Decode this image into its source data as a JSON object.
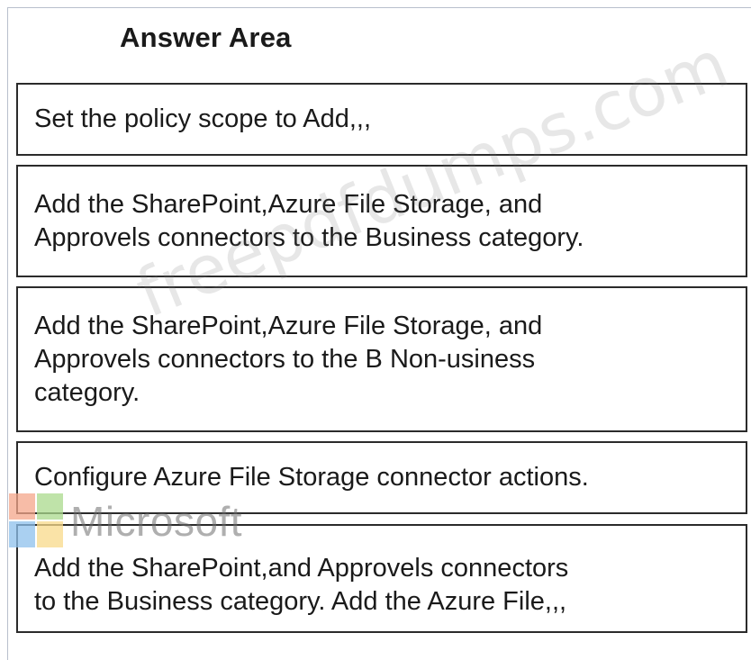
{
  "title": "Answer Area",
  "options": [
    {
      "lines": [
        "Set the policy scope to Add,,,"
      ]
    },
    {
      "lines": [
        "Add the SharePoint,Azure File Storage, and",
        "Approvels connectors to the Business category."
      ]
    },
    {
      "lines": [
        "Add the SharePoint,Azure File Storage, and",
        "Approvels connectors to the B Non-usiness",
        "category."
      ]
    },
    {
      "lines": [
        "Configure Azure File Storage connector actions."
      ]
    },
    {
      "lines": [
        "Add the SharePoint,and Approvels connectors",
        "to the Business category. Add the Azure File,,,"
      ]
    }
  ],
  "watermark": {
    "text": "freepdfdumps.com",
    "logo_text": "Microsoft",
    "logo_colors": [
      "#f4a58a",
      "#a9d98c",
      "#8ec0ec",
      "#f8d98a"
    ]
  }
}
